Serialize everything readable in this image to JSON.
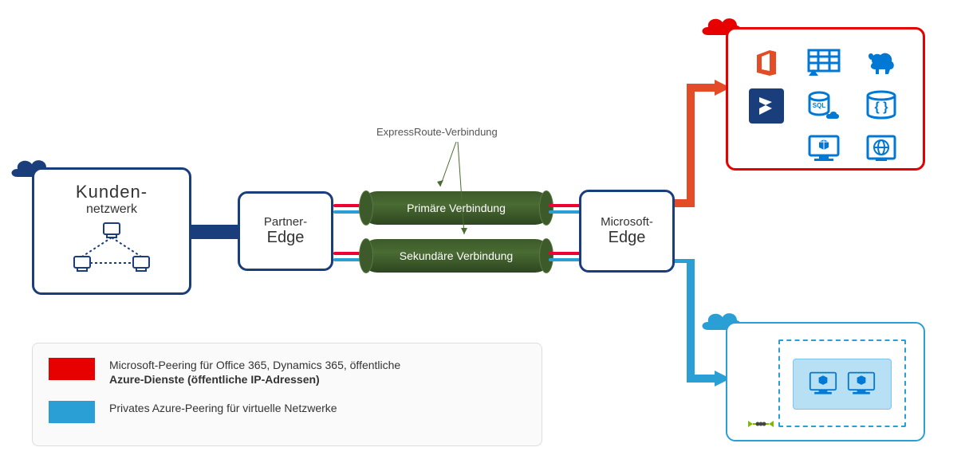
{
  "customer": {
    "title": "Kunden-",
    "subtitle": "netzwerk"
  },
  "partner": {
    "title": "Partner-",
    "subtitle": "Edge"
  },
  "microsoft": {
    "title": "Microsoft-",
    "subtitle": "Edge"
  },
  "pipes": {
    "primary": "Primäre Verbindung",
    "secondary": "Sekundäre Verbindung",
    "note": "ExpressRoute-Verbindung"
  },
  "legend": {
    "red": {
      "line1": "Microsoft-Peering für Office 365, Dynamics 365, öffentliche",
      "line2": "Azure-Dienste (öffentliche IP-Adressen)"
    },
    "blue": "Privates Azure-Peering für virtuelle Netzwerke"
  },
  "colors": {
    "navy": "#1a3d7c",
    "red": "#e60000",
    "azure": "#2a9fd6"
  }
}
